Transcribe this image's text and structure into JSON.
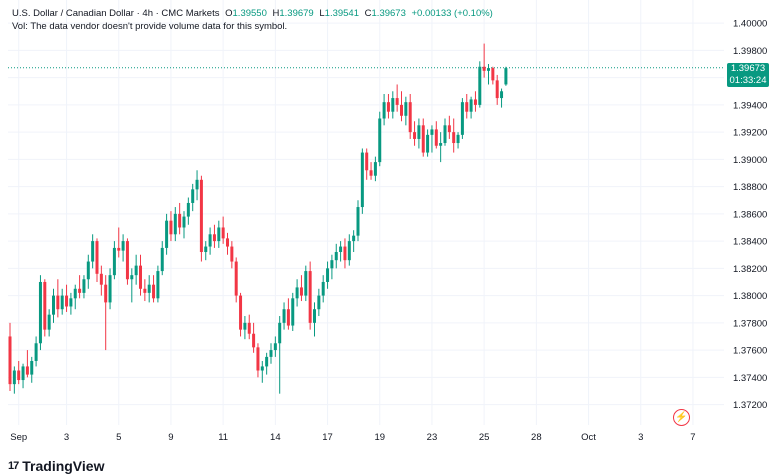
{
  "legend": {
    "symbol": "U.S. Dollar / Canadian Dollar · 4h · CMC Markets",
    "o_label": "O",
    "o_value": "1.39550",
    "h_label": "H",
    "h_value": "1.39679",
    "l_label": "L",
    "l_value": "1.39541",
    "c_label": "C",
    "c_value": "1.39673",
    "change": "+0.00133 (+0.10%)",
    "vol_note": "Vol: The data vendor doesn't provide volume data for this symbol."
  },
  "price_tag": {
    "price": "1.39673",
    "countdown": "01:33:24"
  },
  "logo": {
    "mark": "17",
    "text": "TradingView"
  },
  "icons": {
    "alert": "lightning-icon"
  },
  "colors": {
    "up": "#089981",
    "down": "#f23645",
    "grid": "#f0f3fa",
    "axis_text": "#131722"
  },
  "chart_data": {
    "type": "candlestick",
    "ylim": [
      1.3705,
      1.4017
    ],
    "y_ticks": [
      "1.37200",
      "1.37400",
      "1.37600",
      "1.37800",
      "1.38000",
      "1.38200",
      "1.38400",
      "1.38600",
      "1.38800",
      "1.39000",
      "1.39200",
      "1.39400",
      "1.39600",
      "1.39800",
      "1.40000"
    ],
    "x_ticks": [
      {
        "label": "Sep",
        "index": 2
      },
      {
        "label": "3",
        "index": 13
      },
      {
        "label": "5",
        "index": 25
      },
      {
        "label": "9",
        "index": 37
      },
      {
        "label": "11",
        "index": 49
      },
      {
        "label": "14",
        "index": 61
      },
      {
        "label": "17",
        "index": 73
      },
      {
        "label": "19",
        "index": 85
      },
      {
        "label": "23",
        "index": 97
      },
      {
        "label": "25",
        "index": 109
      },
      {
        "label": "28",
        "index": 121
      },
      {
        "label": "Oct",
        "index": 133
      },
      {
        "label": "3",
        "index": 145
      },
      {
        "label": "7",
        "index": 157
      }
    ],
    "last_price": 1.39673,
    "candles": [
      [
        1.377,
        1.378,
        1.373,
        1.3735
      ],
      [
        1.3735,
        1.3748,
        1.3728,
        1.3745
      ],
      [
        1.3745,
        1.3752,
        1.3735,
        1.3738
      ],
      [
        1.3738,
        1.375,
        1.3732,
        1.3748
      ],
      [
        1.3748,
        1.376,
        1.374,
        1.3742
      ],
      [
        1.3742,
        1.3755,
        1.3736,
        1.3752
      ],
      [
        1.3752,
        1.377,
        1.3748,
        1.3765
      ],
      [
        1.3765,
        1.3815,
        1.376,
        1.381
      ],
      [
        1.381,
        1.3812,
        1.377,
        1.3775
      ],
      [
        1.3775,
        1.379,
        1.377,
        1.3786
      ],
      [
        1.3786,
        1.3805,
        1.378,
        1.38
      ],
      [
        1.38,
        1.3812,
        1.3784,
        1.379
      ],
      [
        1.379,
        1.3805,
        1.3786,
        1.38
      ],
      [
        1.38,
        1.3808,
        1.3788,
        1.3792
      ],
      [
        1.3792,
        1.3802,
        1.3786,
        1.3798
      ],
      [
        1.3798,
        1.3808,
        1.379,
        1.3805
      ],
      [
        1.3805,
        1.3815,
        1.3798,
        1.3802
      ],
      [
        1.3802,
        1.3815,
        1.3798,
        1.3812
      ],
      [
        1.3812,
        1.383,
        1.3805,
        1.3825
      ],
      [
        1.3825,
        1.3845,
        1.382,
        1.384
      ],
      [
        1.384,
        1.3842,
        1.381,
        1.3816
      ],
      [
        1.3816,
        1.3822,
        1.38,
        1.3808
      ],
      [
        1.3808,
        1.3815,
        1.376,
        1.3795
      ],
      [
        1.3795,
        1.382,
        1.379,
        1.3815
      ],
      [
        1.3815,
        1.384,
        1.3812,
        1.3835
      ],
      [
        1.3835,
        1.385,
        1.3828,
        1.3833
      ],
      [
        1.3833,
        1.3845,
        1.3825,
        1.384
      ],
      [
        1.384,
        1.3842,
        1.3808,
        1.3812
      ],
      [
        1.3812,
        1.382,
        1.3795,
        1.3815
      ],
      [
        1.3815,
        1.383,
        1.3808,
        1.3822
      ],
      [
        1.3822,
        1.383,
        1.38,
        1.3805
      ],
      [
        1.3805,
        1.3812,
        1.3796,
        1.3802
      ],
      [
        1.3802,
        1.3815,
        1.3795,
        1.3808
      ],
      [
        1.3808,
        1.3815,
        1.3795,
        1.3798
      ],
      [
        1.3798,
        1.3822,
        1.3795,
        1.3818
      ],
      [
        1.3818,
        1.384,
        1.3815,
        1.3835
      ],
      [
        1.3835,
        1.386,
        1.383,
        1.3855
      ],
      [
        1.3855,
        1.3862,
        1.384,
        1.3845
      ],
      [
        1.3845,
        1.3865,
        1.384,
        1.386
      ],
      [
        1.386,
        1.3868,
        1.3845,
        1.385
      ],
      [
        1.385,
        1.3862,
        1.3842,
        1.3858
      ],
      [
        1.3858,
        1.3872,
        1.3852,
        1.3868
      ],
      [
        1.3868,
        1.3882,
        1.3862,
        1.3878
      ],
      [
        1.3878,
        1.3892,
        1.387,
        1.3885
      ],
      [
        1.3885,
        1.3888,
        1.3825,
        1.3832
      ],
      [
        1.3832,
        1.384,
        1.3826,
        1.3836
      ],
      [
        1.3836,
        1.385,
        1.383,
        1.3845
      ],
      [
        1.3845,
        1.3852,
        1.3835,
        1.384
      ],
      [
        1.384,
        1.3855,
        1.3835,
        1.385
      ],
      [
        1.385,
        1.3858,
        1.3838,
        1.3842
      ],
      [
        1.3842,
        1.3846,
        1.383,
        1.3836
      ],
      [
        1.3836,
        1.384,
        1.382,
        1.3825
      ],
      [
        1.3825,
        1.3828,
        1.3795,
        1.38
      ],
      [
        1.38,
        1.3802,
        1.377,
        1.3775
      ],
      [
        1.3775,
        1.3785,
        1.3768,
        1.378
      ],
      [
        1.378,
        1.3786,
        1.3768,
        1.3772
      ],
      [
        1.3772,
        1.378,
        1.3758,
        1.3762
      ],
      [
        1.3762,
        1.3765,
        1.374,
        1.3745
      ],
      [
        1.3745,
        1.3752,
        1.3736,
        1.3748
      ],
      [
        1.3748,
        1.3758,
        1.3742,
        1.3755
      ],
      [
        1.3755,
        1.3765,
        1.375,
        1.376
      ],
      [
        1.376,
        1.377,
        1.3755,
        1.3765
      ],
      [
        1.3765,
        1.3785,
        1.3728,
        1.378
      ],
      [
        1.378,
        1.3795,
        1.3775,
        1.379
      ],
      [
        1.379,
        1.3798,
        1.3775,
        1.3778
      ],
      [
        1.3778,
        1.3802,
        1.3774,
        1.3798
      ],
      [
        1.3798,
        1.3812,
        1.3792,
        1.3806
      ],
      [
        1.3806,
        1.3815,
        1.3796,
        1.38
      ],
      [
        1.38,
        1.3822,
        1.3796,
        1.3818
      ],
      [
        1.3818,
        1.3825,
        1.3775,
        1.378
      ],
      [
        1.378,
        1.3795,
        1.377,
        1.379
      ],
      [
        1.379,
        1.3805,
        1.3785,
        1.38
      ],
      [
        1.38,
        1.3815,
        1.3795,
        1.381
      ],
      [
        1.381,
        1.3825,
        1.3805,
        1.382
      ],
      [
        1.382,
        1.383,
        1.3812,
        1.3826
      ],
      [
        1.3826,
        1.3838,
        1.382,
        1.3832
      ],
      [
        1.3832,
        1.384,
        1.3825,
        1.3836
      ],
      [
        1.3836,
        1.3842,
        1.382,
        1.3826
      ],
      [
        1.3826,
        1.3845,
        1.3822,
        1.384
      ],
      [
        1.384,
        1.3848,
        1.3832,
        1.3844
      ],
      [
        1.3844,
        1.387,
        1.384,
        1.3865
      ],
      [
        1.3865,
        1.3908,
        1.386,
        1.3905
      ],
      [
        1.3905,
        1.3908,
        1.3885,
        1.3892
      ],
      [
        1.3892,
        1.3898,
        1.3885,
        1.3888
      ],
      [
        1.3888,
        1.3902,
        1.3884,
        1.3898
      ],
      [
        1.3898,
        1.3935,
        1.3895,
        1.393
      ],
      [
        1.393,
        1.3948,
        1.3925,
        1.3942
      ],
      [
        1.3942,
        1.3948,
        1.393,
        1.3935
      ],
      [
        1.3935,
        1.395,
        1.393,
        1.3945
      ],
      [
        1.3945,
        1.3955,
        1.3935,
        1.394
      ],
      [
        1.394,
        1.395,
        1.3928,
        1.3932
      ],
      [
        1.3932,
        1.3946,
        1.3925,
        1.3942
      ],
      [
        1.3942,
        1.3948,
        1.3915,
        1.392
      ],
      [
        1.392,
        1.3928,
        1.391,
        1.3915
      ],
      [
        1.3915,
        1.393,
        1.3908,
        1.3925
      ],
      [
        1.3925,
        1.393,
        1.3902,
        1.3905
      ],
      [
        1.3905,
        1.3922,
        1.3902,
        1.3918
      ],
      [
        1.3918,
        1.3925,
        1.3905,
        1.3922
      ],
      [
        1.3922,
        1.3928,
        1.3908,
        1.391
      ],
      [
        1.391,
        1.392,
        1.3898,
        1.3912
      ],
      [
        1.3912,
        1.393,
        1.391,
        1.3925
      ],
      [
        1.3925,
        1.3932,
        1.3915,
        1.392
      ],
      [
        1.392,
        1.393,
        1.3905,
        1.3912
      ],
      [
        1.3912,
        1.392,
        1.3908,
        1.3918
      ],
      [
        1.3918,
        1.3945,
        1.3915,
        1.3942
      ],
      [
        1.3942,
        1.3948,
        1.393,
        1.3935
      ],
      [
        1.3935,
        1.3946,
        1.393,
        1.3944
      ],
      [
        1.3944,
        1.395,
        1.3935,
        1.394
      ],
      [
        1.394,
        1.3972,
        1.3938,
        1.3968
      ],
      [
        1.3968,
        1.3985,
        1.396,
        1.3965
      ],
      [
        1.3965,
        1.397,
        1.3955,
        1.3967
      ],
      [
        1.3967,
        1.3968,
        1.3955,
        1.3958
      ],
      [
        1.3958,
        1.3962,
        1.394,
        1.3945
      ],
      [
        1.3945,
        1.3952,
        1.3938,
        1.395
      ],
      [
        1.3955,
        1.3968,
        1.3954,
        1.3967
      ]
    ]
  }
}
